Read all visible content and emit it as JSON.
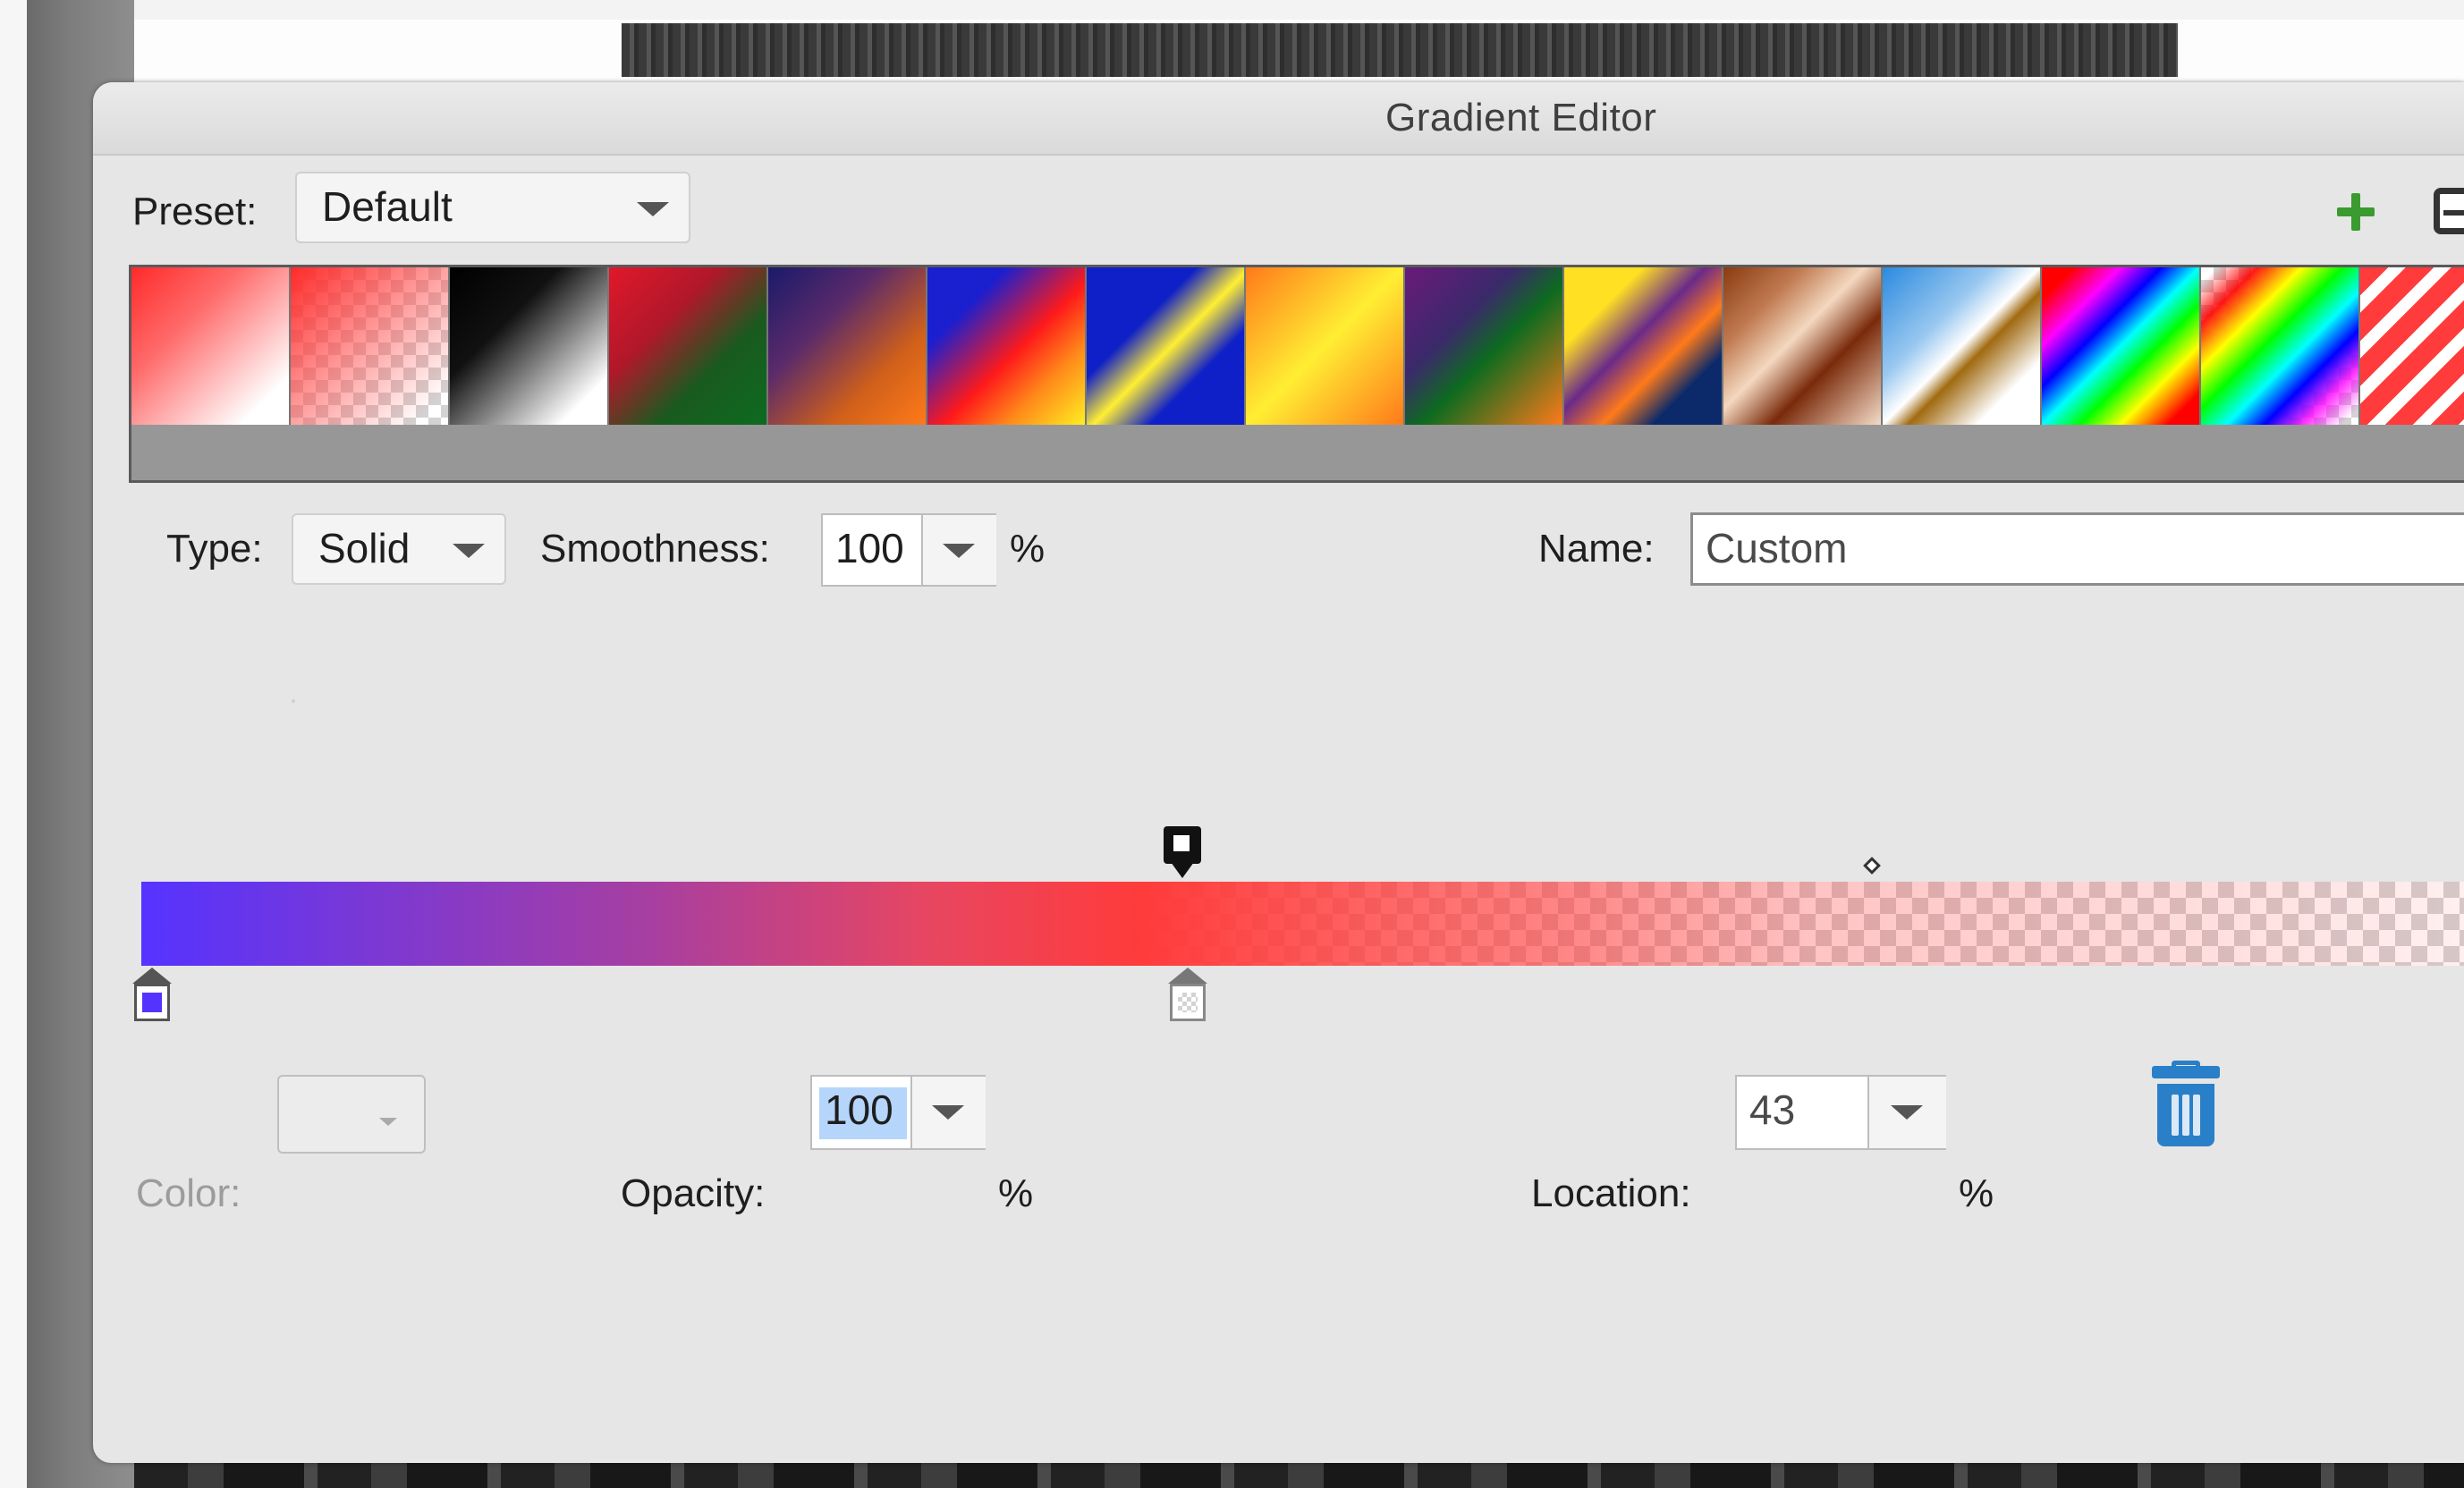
{
  "dialog": {
    "title": "Gradient Editor"
  },
  "preset": {
    "label": "Preset:",
    "value": "Default",
    "add_icon": "plus-icon",
    "save_icon": "save-icon"
  },
  "presets": [
    {
      "name": "red-to-white",
      "colors": [
        "#ff3b3b",
        "#ffffff"
      ]
    },
    {
      "name": "red-to-transparent",
      "colors": [
        "#ff3b3b",
        "transparent"
      ]
    },
    {
      "name": "black-to-white",
      "colors": [
        "#000000",
        "#ffffff"
      ]
    },
    {
      "name": "red-to-green",
      "colors": [
        "#e0182a",
        "#0d6b1f"
      ]
    },
    {
      "name": "violet-to-orange",
      "colors": [
        "#2a1a70",
        "#ff7a1a"
      ]
    },
    {
      "name": "blue-red-yellow",
      "colors": [
        "#1a1fd0",
        "#ff1a1a",
        "#ffee22"
      ]
    },
    {
      "name": "blue-yellow-blue",
      "colors": [
        "#1020c8",
        "#ffee33",
        "#1020c8"
      ]
    },
    {
      "name": "orange-yellow-orange",
      "colors": [
        "#ff7a1a",
        "#ffee33",
        "#ff7a1a"
      ]
    },
    {
      "name": "violet-green-orange",
      "colors": [
        "#6a1a7a",
        "#0d6b1f",
        "#ff7a1a"
      ]
    },
    {
      "name": "yellow-violet-orange-blue",
      "colors": [
        "#ffe022",
        "#6a2a8a",
        "#ff7a1a",
        "#0c2a6a"
      ]
    },
    {
      "name": "copper",
      "colors": [
        "#8a3a10",
        "#f3d8c0",
        "#7a2a0a",
        "#f4dcc8"
      ]
    },
    {
      "name": "chrome",
      "colors": [
        "#2a8adf",
        "#ffffff",
        "#a06a10",
        "#ffffff"
      ]
    },
    {
      "name": "spectrum",
      "colors": [
        "#ff0000",
        "#ff00ff",
        "#0000ff",
        "#00ffff",
        "#00ff00",
        "#ffff00",
        "#ff0000"
      ]
    },
    {
      "name": "transparent-rainbow",
      "colors": [
        "#ff0000",
        "#ffff00",
        "#00ff00",
        "#00ffff",
        "#0000ff",
        "#ff00ff"
      ]
    },
    {
      "name": "transparent-stripes",
      "colors": [
        "#ff3b3b",
        "#ffffff"
      ]
    }
  ],
  "type": {
    "label": "Type:",
    "value": "Solid"
  },
  "smoothness": {
    "label": "Smoothness:",
    "value": "100",
    "unit": "%"
  },
  "name": {
    "label": "Name:",
    "value": "Custom"
  },
  "gradient": {
    "stops": [
      {
        "color": "#5533ff",
        "location": 0
      },
      {
        "color": "#ff3b3b",
        "location": 43
      }
    ],
    "opacity_stops": [
      {
        "opacity": 100,
        "location": 43
      },
      {
        "opacity": 0,
        "location": 100
      }
    ],
    "midpoint_location": 71
  },
  "color": {
    "label": "Color:"
  },
  "opacity": {
    "label": "Opacity:",
    "value": "100",
    "unit": "%"
  },
  "location": {
    "label": "Location:",
    "value": "43",
    "unit": "%"
  },
  "delete_icon": "trash-icon"
}
